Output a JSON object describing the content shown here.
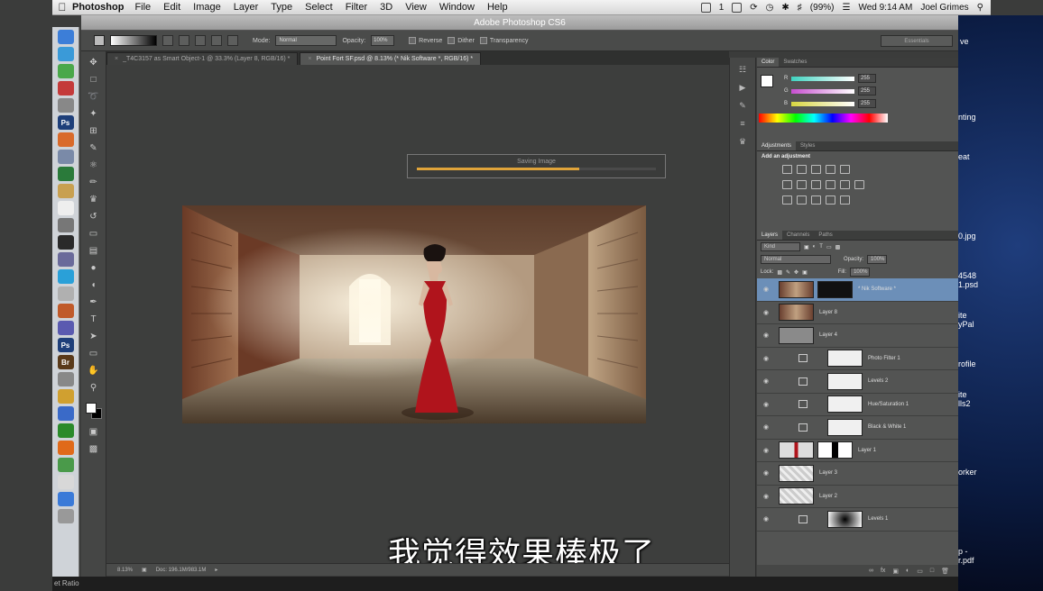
{
  "menubar": {
    "app": "Photoshop",
    "items": [
      "File",
      "Edit",
      "Image",
      "Layer",
      "Type",
      "Select",
      "Filter",
      "3D",
      "View",
      "Window",
      "Help"
    ],
    "battery": "(99%)",
    "clock": "Wed 9:14 AM",
    "user": "Joel Grimes",
    "one": "1"
  },
  "window_title": "Adobe Photoshop CS6",
  "options": {
    "mode_label": "Mode:",
    "mode_value": "Normal",
    "opacity_label": "Opacity:",
    "opacity_value": "100%",
    "reverse": "Reverse",
    "dither": "Dither",
    "transparency": "Transparency",
    "workspace": "Essentials"
  },
  "tabs": [
    {
      "label": "_T4C3157 as Smart Object-1 @ 33.3% (Layer 8, RGB/16) *"
    },
    {
      "label": "Point Fort SF.psd @ 8.13% (* Nik Software *, RGB/16) *"
    }
  ],
  "progress": {
    "label": "Saving Image",
    "fraction": 0.68
  },
  "status": {
    "zoom": "8.13%",
    "doc": "Doc: 196.1M/983.1M"
  },
  "subtitle": "我觉得效果棒极了",
  "color_panel": {
    "tabs": [
      "Color",
      "Swatches"
    ],
    "channels": [
      {
        "name": "R",
        "value": "255",
        "color": "#3fd3c0"
      },
      {
        "name": "G",
        "value": "255",
        "color": "#c74fd0"
      },
      {
        "name": "B",
        "value": "255",
        "color": "#d8d640"
      }
    ]
  },
  "adjustments_panel": {
    "tabs": [
      "Adjustments",
      "Styles"
    ],
    "heading": "Add an adjustment"
  },
  "layers_panel": {
    "tabs": [
      "Layers",
      "Channels",
      "Paths"
    ],
    "kind": "Kind",
    "blend_mode": "Normal",
    "opacity_label": "Opacity:",
    "opacity_value": "100%",
    "lock_label": "Lock:",
    "fill_label": "Fill:",
    "fill_value": "100%",
    "layers": [
      {
        "name": "* Nik Software *",
        "selected": true
      },
      {
        "name": "Layer 8"
      },
      {
        "name": "Layer 4"
      },
      {
        "name": "Photo Filter 1"
      },
      {
        "name": "Levels 2"
      },
      {
        "name": "Hue/Saturation 1"
      },
      {
        "name": "Black & White 1"
      },
      {
        "name": "Layer 1"
      },
      {
        "name": "Layer 3"
      },
      {
        "name": "Layer 2"
      },
      {
        "name": "Levels 1"
      }
    ]
  },
  "desktop": {
    "labels": [
      "ve",
      "nting",
      "eat",
      "0.jpg",
      "4548",
      "1.psd",
      "ite",
      "yPal",
      "rofile",
      "ite",
      "lls2",
      "orker",
      "p -",
      "r.pdf"
    ]
  },
  "bottom_strip": "et Ratio"
}
